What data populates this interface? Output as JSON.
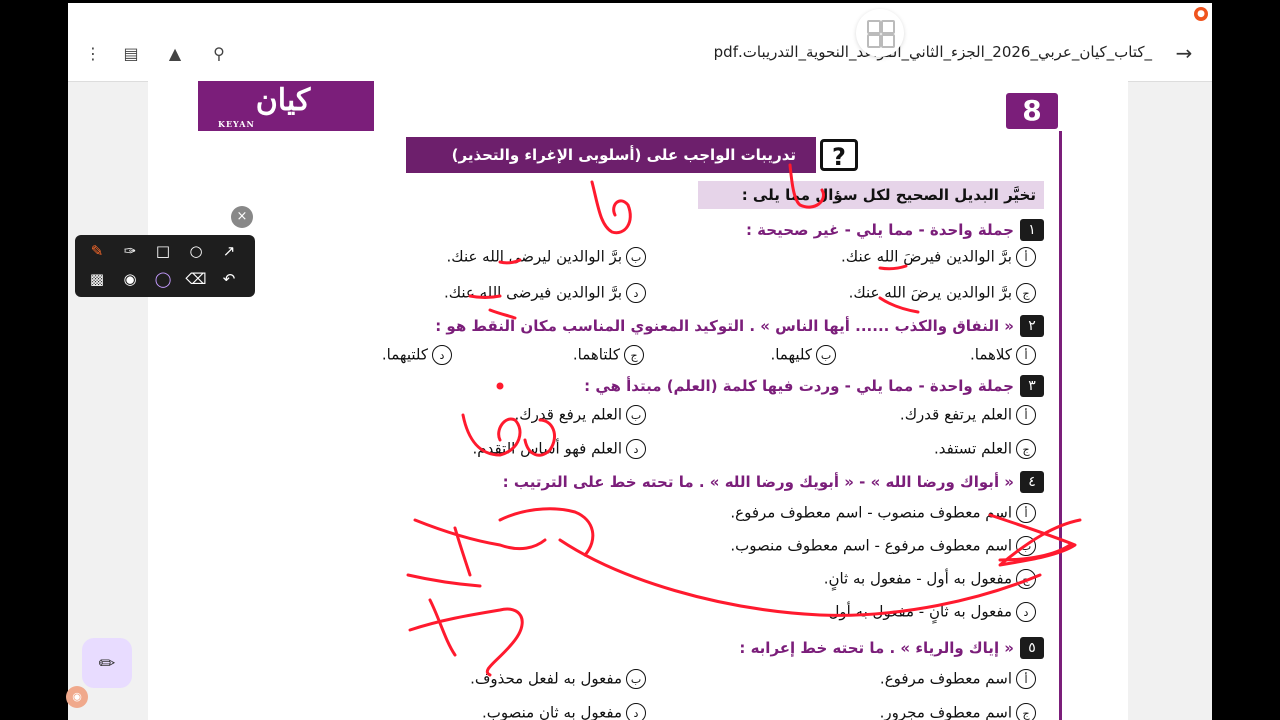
{
  "viewer": {
    "file_name": "_كتاب_كيان_عربي_2026_الجزء_الثاني_القواعد_النحوية_التدريبات.pdf",
    "back_icon": "arrow-right-icon",
    "toolbar_icons": [
      "search-doc-icon",
      "drive-add-icon",
      "reader-mode-icon",
      "more-vert-icon"
    ]
  },
  "worksheet": {
    "logo_text": "كيان",
    "logo_sub": "KEYAN",
    "page_number": "8",
    "banner": "تدريبات الواجب على (أسلوبى الإغراء والتحذير)",
    "qmark": "?",
    "instruction": "تخيَّر البديل الصحيح لكل سؤال مما يلى :",
    "questions": [
      {
        "num": "١",
        "text": "جملة واحدة - مما يلي - غير صحيحة :",
        "options": [
          {
            "letter": "أ",
            "text": "برَّ الوالدين فيرضَ الله عنك."
          },
          {
            "letter": "ب",
            "text": "برَّ الوالدين ليرضى الله عنك."
          },
          {
            "letter": "ج",
            "text": "برَّ الوالدين يرضَ الله عنك."
          },
          {
            "letter": "د",
            "text": "برَّ الوالدين فيرضى الله عنك."
          }
        ]
      },
      {
        "num": "٢",
        "text": "« النفاق والكذب ...... أيها الناس » . التوكيد المعنوي المناسب مكان النقط هو :",
        "options": [
          {
            "letter": "أ",
            "text": "كلاهما."
          },
          {
            "letter": "ب",
            "text": "كليهما."
          },
          {
            "letter": "ج",
            "text": "كلتاهما."
          },
          {
            "letter": "د",
            "text": "كلتيهما."
          }
        ]
      },
      {
        "num": "٣",
        "text": "جملة واحدة - مما يلي - وردت فيها كلمة (العلم) مبتدأ هي :",
        "options": [
          {
            "letter": "أ",
            "text": "العلم يرتفع قدرك."
          },
          {
            "letter": "ب",
            "text": "العلم يرفع قدرك."
          },
          {
            "letter": "ج",
            "text": "العلم تستفد."
          },
          {
            "letter": "د",
            "text": "العلم فهو أساس التقدم."
          }
        ]
      },
      {
        "num": "٤",
        "text": "« أبواك ورضا الله » - « أبويك ورضا الله » . ما تحته خط على الترتيب :",
        "options": [
          {
            "letter": "أ",
            "text": "اسم معطوف منصوب - اسم معطوف مرفوع."
          },
          {
            "letter": "ب",
            "text": "اسم معطوف مرفوع - اسم معطوف منصوب."
          },
          {
            "letter": "ج",
            "text": "مفعول به أول - مفعول به ثانٍ."
          },
          {
            "letter": "د",
            "text": "مفعول به ثانٍ - مفعول به أول."
          }
        ]
      },
      {
        "num": "٥",
        "text": "« إياك والرياء » . ما تحته خط إعرابه :",
        "options": [
          {
            "letter": "أ",
            "text": "اسم معطوف مرفوع."
          },
          {
            "letter": "ب",
            "text": "مفعول به لفعل محذوف."
          },
          {
            "letter": "ج",
            "text": "اسم معطوف مجرور."
          },
          {
            "letter": "د",
            "text": "مفعول به ثانٍ منصوب."
          }
        ]
      }
    ]
  },
  "annotation_toolbar": {
    "tools": [
      "pen-icon",
      "highlighter-icon",
      "rectangle-icon",
      "circle-icon",
      "arrow-icon",
      "whiteboard-icon",
      "camera-icon",
      "color-wheel-icon",
      "eraser-icon",
      "undo-icon"
    ],
    "close_label": "×"
  },
  "colors": {
    "brand_purple": "#7b1e7a",
    "ink_red": "#ff1a2e"
  }
}
